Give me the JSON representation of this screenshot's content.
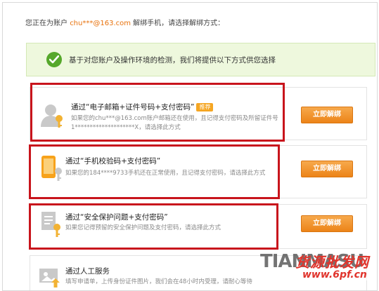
{
  "header": {
    "prefix": "您正在为账户",
    "account": "chu***@163.com",
    "suffix": "解绑手机，请选择解绑方式："
  },
  "notice": {
    "text": "基于对您账户及操作环境的检测，我们将提供以下方式供您选择"
  },
  "options": [
    {
      "title": "通过“电子邮箱+证件号码+支付密码”",
      "badge": "推荐",
      "desc": "如果您的chu***@163.com账户邮箱还在使用，且记得支付密码及所留证件号1********************X，请选择此方式",
      "button": "立即解绑"
    },
    {
      "title": "通过“手机校验码+支付密码”",
      "desc": "如果您的184****9733手机还在正常使用，且记得支付密码，请选择此方式",
      "button": "立即解绑"
    },
    {
      "title": "通过“安全保护问题+支付密码”",
      "desc": "如果您记得预留的安全保护问题及支付密码，请选择此方式",
      "button": "立即解绑"
    },
    {
      "title": "通过人工服务",
      "desc": "填写申请单，上传身份证件图片，我们会在48小时内受理，请耐心等待"
    }
  ],
  "watermark": {
    "brand": "TIANMASU",
    "cn": "货源批发网",
    "url": "www.6pf.cn"
  },
  "colors": {
    "accent": "#e8720c",
    "button": "#ec8418",
    "highlight": "#c8141c",
    "notice_bg": "#eef8dd",
    "check": "#56a82b"
  }
}
